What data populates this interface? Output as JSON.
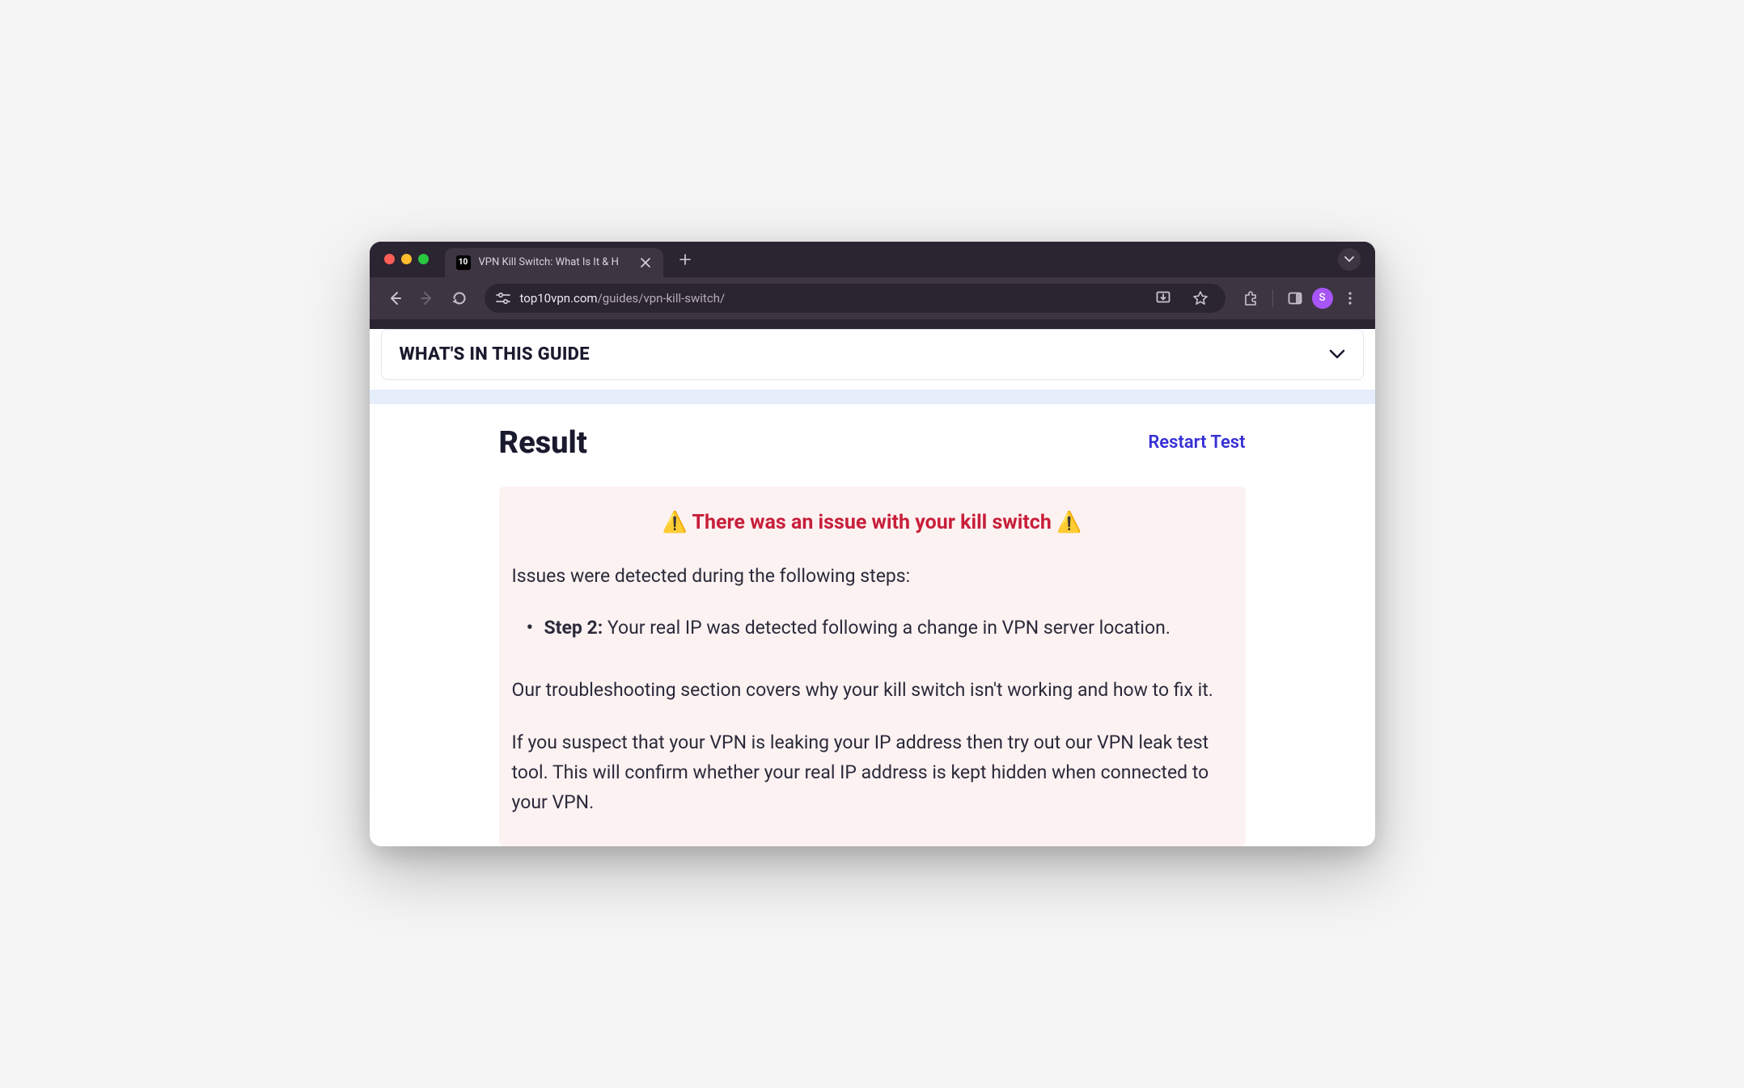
{
  "browser": {
    "tab": {
      "favicon_text": "10",
      "title": "VPN Kill Switch: What Is It & H"
    },
    "url_domain": "top10vpn.com",
    "url_path": "/guides/vpn-kill-switch/",
    "profile_initial": "S"
  },
  "toc": {
    "title": "WHAT'S IN THIS GUIDE"
  },
  "result": {
    "heading": "Result",
    "restart_label": "Restart Test",
    "alert_text": "⚠️ There was an issue with your kill switch ⚠️",
    "intro": "Issues were detected during the following steps:",
    "issues": [
      {
        "step_label": "Step 2:",
        "text": " Your real IP was detected following a change in VPN server location."
      }
    ],
    "troubleshoot": "Our troubleshooting section covers why your kill switch isn't working and how to fix it.",
    "leak_test": "If you suspect that your VPN is leaking your IP address then try out our VPN leak test tool. This will confirm whether your real IP address is kept hidden when connected to your VPN."
  }
}
